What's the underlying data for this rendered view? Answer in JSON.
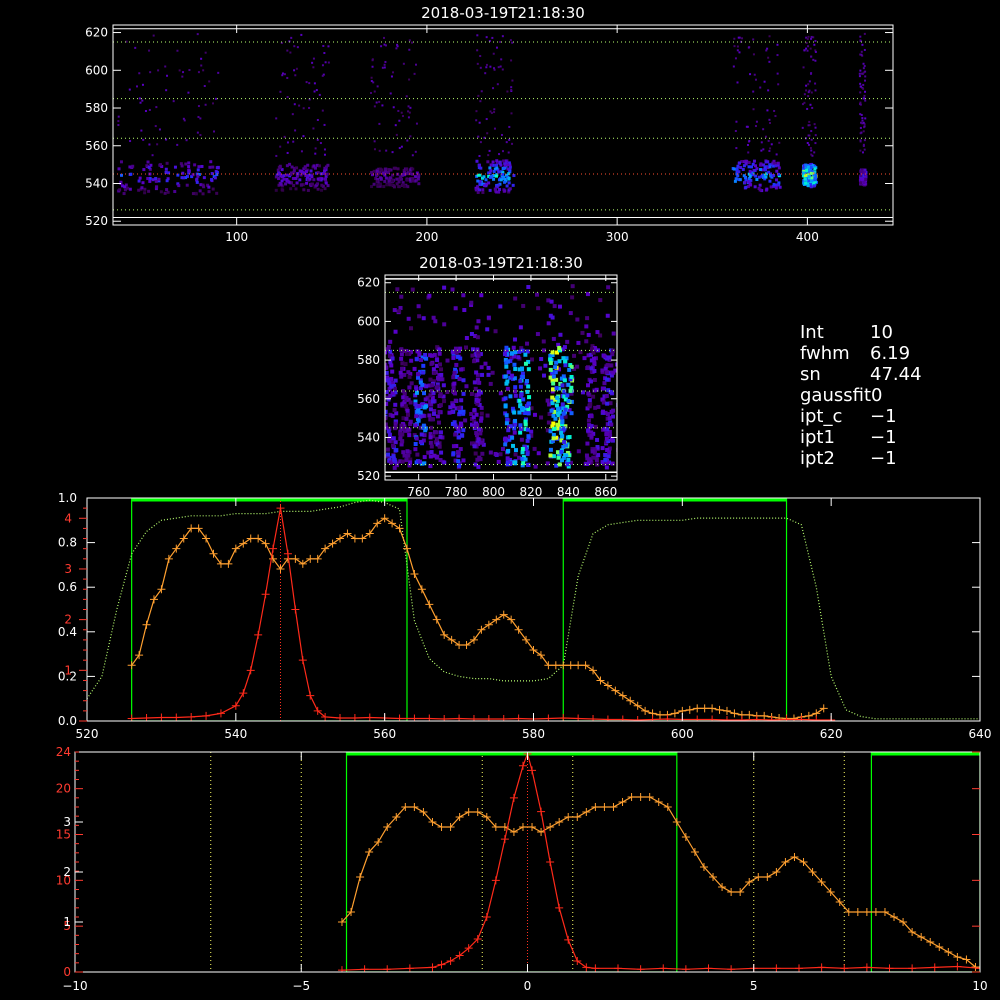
{
  "info_panel": [
    {
      "key": "Int",
      "value": "10"
    },
    {
      "key": "fwhm",
      "value": "6.19"
    },
    {
      "key": "sn",
      "value": "47.44"
    },
    {
      "key": "gaussfit",
      "value": "0"
    },
    {
      "key": "ipt_c",
      "value": "−1"
    },
    {
      "key": "ipt1",
      "value": "−1"
    },
    {
      "key": "ipt2",
      "value": "−1"
    }
  ],
  "colors": {
    "background": "#000000",
    "axes": "#ffffff",
    "mean_profile": "#ffa030",
    "line_profile": "#ff2a1a",
    "window": "#00ff00",
    "throughput": "#b8ff70",
    "guide_lines": "#ffff66"
  },
  "chart_data": [
    {
      "type": "heatmap",
      "title": "2018-03-19T21:18:30",
      "x_range": [
        35,
        445
      ],
      "y_range": [
        518,
        624
      ],
      "x_ticks": [
        100,
        200,
        300,
        400
      ],
      "y_ticks": [
        520,
        540,
        560,
        580,
        600,
        620
      ],
      "guide_lines_y": [
        526,
        545,
        564,
        585,
        615
      ],
      "intensity_blocks": [
        {
          "x": [
            37,
            90
          ],
          "y": [
            535,
            553
          ],
          "level": 0.45
        },
        {
          "x": [
            120,
            148
          ],
          "y": [
            537,
            551
          ],
          "level": 0.35
        },
        {
          "x": [
            170,
            195
          ],
          "y": [
            539,
            549
          ],
          "level": 0.25
        },
        {
          "x": [
            225,
            245
          ],
          "y": [
            536,
            553
          ],
          "level": 0.65
        },
        {
          "x": [
            360,
            385
          ],
          "y": [
            537,
            553
          ],
          "level": 0.6
        },
        {
          "x": [
            397,
            404
          ],
          "y": [
            539,
            551
          ],
          "level": 0.85
        },
        {
          "x": [
            427,
            430
          ],
          "y": [
            540,
            548
          ],
          "level": 0.35
        }
      ],
      "grid": false
    },
    {
      "type": "heatmap",
      "title": "2018-03-19T21:18:30",
      "x_range": [
        742,
        866
      ],
      "y_range": [
        518,
        624
      ],
      "x_ticks": [
        760,
        780,
        800,
        820,
        840,
        860
      ],
      "y_ticks": [
        520,
        540,
        560,
        580,
        600,
        620
      ],
      "guide_lines_y": [
        526,
        545,
        564,
        585,
        615
      ],
      "intensity_columns": [
        {
          "x": 744,
          "level": 0.35
        },
        {
          "x": 752,
          "level": 0.25
        },
        {
          "x": 760,
          "level": 0.5
        },
        {
          "x": 768,
          "level": 0.3
        },
        {
          "x": 780,
          "level": 0.4
        },
        {
          "x": 790,
          "level": 0.3
        },
        {
          "x": 808,
          "level": 0.55
        },
        {
          "x": 815,
          "level": 0.65
        },
        {
          "x": 832,
          "level": 0.85
        },
        {
          "x": 838,
          "level": 0.75
        },
        {
          "x": 852,
          "level": 0.3
        },
        {
          "x": 860,
          "level": 0.35
        }
      ],
      "grid": false
    },
    {
      "type": "line",
      "x_range": [
        520,
        640
      ],
      "x_ticks": [
        520,
        540,
        560,
        580,
        600,
        620,
        640
      ],
      "y_left_range": [
        0,
        1.0
      ],
      "y_left_ticks": [
        "0.0",
        "0.2",
        "0.4",
        "0.6",
        "0.8",
        "1.0"
      ],
      "y_left_tick_values": [
        0,
        0.2,
        0.4,
        0.6,
        0.8,
        1.0
      ],
      "y_right_ticks": [
        "1",
        "2",
        "3",
        "4"
      ],
      "y_right_tick_values": [
        1,
        2,
        3,
        4
      ],
      "y_right_range": [
        0,
        4.4
      ],
      "windows": [
        [
          526,
          563
        ],
        [
          584,
          614
        ]
      ],
      "marker_x": 546,
      "series": [
        {
          "x": [
            520,
            522,
            524,
            526,
            528,
            530,
            532,
            534,
            536,
            538,
            540,
            542,
            544,
            546,
            548,
            550,
            552,
            554,
            556,
            558,
            560,
            562,
            564,
            566,
            568,
            570,
            572,
            574,
            576,
            578,
            580,
            582,
            584,
            586,
            588,
            590,
            592,
            594,
            596,
            598,
            600,
            602,
            604,
            606,
            608,
            610,
            612,
            614,
            616,
            618,
            620,
            622,
            624,
            626,
            628,
            630,
            632,
            634,
            636,
            638,
            640
          ],
          "y": [
            0.1,
            0.2,
            0.5,
            0.75,
            0.85,
            0.9,
            0.91,
            0.92,
            0.92,
            0.92,
            0.93,
            0.93,
            0.93,
            0.94,
            0.94,
            0.94,
            0.95,
            0.96,
            0.98,
            0.99,
            0.98,
            0.95,
            0.45,
            0.28,
            0.22,
            0.2,
            0.19,
            0.19,
            0.18,
            0.18,
            0.18,
            0.19,
            0.25,
            0.65,
            0.84,
            0.88,
            0.89,
            0.9,
            0.9,
            0.9,
            0.9,
            0.91,
            0.91,
            0.91,
            0.91,
            0.91,
            0.91,
            0.91,
            0.88,
            0.6,
            0.2,
            0.05,
            0.02,
            0.01,
            0.01,
            0.01,
            0.01,
            0.01,
            0.01,
            0.01,
            0.01
          ]
        },
        {
          "x": [
            526,
            527,
            528,
            529,
            530,
            531,
            532,
            533,
            534,
            535,
            536,
            537,
            538,
            539,
            540,
            541,
            542,
            543,
            544,
            545,
            546,
            547,
            548,
            549,
            550,
            551,
            552,
            553,
            554,
            555,
            556,
            557,
            558,
            559,
            560,
            561,
            562,
            563,
            564,
            565,
            566,
            567,
            568,
            569,
            570,
            571,
            572,
            573,
            574,
            575,
            576,
            577,
            578,
            579,
            580,
            581,
            582,
            583,
            584,
            585,
            586,
            587,
            588,
            589,
            590,
            591,
            592,
            593,
            594,
            595,
            596,
            597,
            598,
            599,
            600,
            601,
            602,
            603,
            604,
            605,
            606,
            607,
            608,
            609,
            610,
            611,
            612,
            613,
            614,
            615,
            616,
            617,
            618,
            619
          ],
          "y": [
            1.1,
            1.3,
            1.9,
            2.4,
            2.6,
            3.2,
            3.4,
            3.6,
            3.8,
            3.8,
            3.6,
            3.3,
            3.1,
            3.1,
            3.4,
            3.5,
            3.6,
            3.6,
            3.5,
            3.2,
            3.0,
            3.2,
            3.2,
            3.1,
            3.2,
            3.2,
            3.4,
            3.5,
            3.6,
            3.7,
            3.6,
            3.6,
            3.7,
            3.9,
            4.0,
            3.9,
            3.8,
            3.4,
            2.9,
            2.6,
            2.3,
            2.0,
            1.7,
            1.6,
            1.5,
            1.5,
            1.6,
            1.8,
            1.9,
            2.0,
            2.1,
            2.0,
            1.8,
            1.6,
            1.4,
            1.3,
            1.1,
            1.1,
            1.1,
            1.1,
            1.1,
            1.1,
            1.0,
            0.8,
            0.7,
            0.6,
            0.5,
            0.4,
            0.3,
            0.2,
            0.15,
            0.12,
            0.12,
            0.15,
            0.2,
            0.22,
            0.25,
            0.25,
            0.25,
            0.22,
            0.2,
            0.15,
            0.12,
            0.12,
            0.1,
            0.1,
            0.08,
            0.06,
            0.05,
            0.05,
            0.08,
            0.1,
            0.15,
            0.25
          ]
        },
        {
          "x": [
            526,
            528,
            530,
            532,
            534,
            536,
            538,
            540,
            541,
            542,
            543,
            544,
            545,
            546,
            547,
            548,
            549,
            550,
            551,
            552,
            554,
            556,
            558,
            560,
            562,
            564,
            566,
            568,
            570,
            572,
            574,
            576,
            578,
            580,
            582,
            584,
            586,
            588,
            590,
            592,
            594,
            596,
            598,
            600,
            602,
            604,
            606,
            608,
            610,
            612,
            614,
            616,
            618,
            620
          ],
          "y": [
            0.05,
            0.06,
            0.07,
            0.07,
            0.08,
            0.1,
            0.15,
            0.3,
            0.55,
            1.0,
            1.7,
            2.5,
            3.4,
            4.2,
            3.3,
            2.2,
            1.2,
            0.5,
            0.2,
            0.08,
            0.06,
            0.06,
            0.07,
            0.06,
            0.05,
            0.05,
            0.05,
            0.04,
            0.05,
            0.04,
            0.04,
            0.04,
            0.05,
            0.04,
            0.05,
            0.06,
            0.05,
            0.04,
            0.03,
            0.03,
            0.02,
            0.03,
            0.04,
            0.03,
            0.03,
            0.03,
            0.02,
            0.02,
            0.03,
            0.02,
            0.03,
            0.03,
            0.02,
            0.02
          ]
        }
      ],
      "grid": false
    },
    {
      "type": "line",
      "x_range": [
        -10,
        10
      ],
      "x_ticks": [
        -10,
        -5,
        0,
        5,
        10
      ],
      "y_left_ticks": [
        "0",
        "5",
        "10",
        "15",
        "20",
        "24"
      ],
      "y_left_tick_values": [
        0,
        5,
        10,
        15,
        20,
        24
      ],
      "y_left_range": [
        0,
        24
      ],
      "y_right_ticks": [
        "1",
        "2",
        "3"
      ],
      "y_right_tick_values": [
        1,
        2,
        3
      ],
      "y_right_range": [
        0,
        4.4
      ],
      "windows": [
        [
          -4.0,
          3.3
        ],
        [
          7.6,
          10
        ]
      ],
      "guide_lines_x": [
        -7,
        -5,
        -1,
        1,
        5,
        7
      ],
      "marker_x": 0,
      "series": [
        {
          "x": [
            -4.1,
            -3.9,
            -3.7,
            -3.5,
            -3.3,
            -3.1,
            -2.9,
            -2.7,
            -2.5,
            -2.3,
            -2.1,
            -1.9,
            -1.7,
            -1.5,
            -1.3,
            -1.1,
            -0.9,
            -0.7,
            -0.5,
            -0.3,
            -0.1,
            0.1,
            0.3,
            0.5,
            0.7,
            0.9,
            1.1,
            1.3,
            1.5,
            1.7,
            1.9,
            2.1,
            2.3,
            2.5,
            2.7,
            2.9,
            3.1,
            3.3,
            3.5,
            3.7,
            3.9,
            4.1,
            4.3,
            4.5,
            4.7,
            4.9,
            5.1,
            5.3,
            5.5,
            5.7,
            5.9,
            6.1,
            6.3,
            6.5,
            6.7,
            6.9,
            7.1,
            7.3,
            7.5,
            7.7,
            7.9,
            8.1,
            8.3,
            8.5,
            8.7,
            8.9,
            9.1,
            9.3,
            9.5,
            9.7,
            9.9
          ],
          "y": [
            1.0,
            1.2,
            1.9,
            2.4,
            2.6,
            2.9,
            3.1,
            3.3,
            3.3,
            3.2,
            3.0,
            2.9,
            2.9,
            3.1,
            3.2,
            3.2,
            3.1,
            2.9,
            2.9,
            2.8,
            2.9,
            2.9,
            2.8,
            2.9,
            3.0,
            3.1,
            3.1,
            3.2,
            3.3,
            3.3,
            3.3,
            3.4,
            3.5,
            3.5,
            3.5,
            3.4,
            3.3,
            3.0,
            2.7,
            2.4,
            2.1,
            1.9,
            1.7,
            1.6,
            1.6,
            1.8,
            1.9,
            1.9,
            2.0,
            2.2,
            2.3,
            2.2,
            2.0,
            1.8,
            1.6,
            1.4,
            1.2,
            1.2,
            1.2,
            1.2,
            1.2,
            1.1,
            1.0,
            0.8,
            0.7,
            0.6,
            0.5,
            0.4,
            0.3,
            0.25,
            0.1
          ]
        },
        {
          "x": [
            -4.1,
            -3.6,
            -3.1,
            -2.6,
            -2.1,
            -1.9,
            -1.7,
            -1.5,
            -1.3,
            -1.1,
            -0.9,
            -0.7,
            -0.5,
            -0.3,
            -0.1,
            0,
            0.1,
            0.3,
            0.5,
            0.7,
            0.9,
            1.1,
            1.3,
            1.5,
            2.0,
            2.5,
            3.0,
            3.5,
            4.0,
            4.5,
            5.0,
            5.5,
            6.0,
            6.5,
            7.0,
            7.5,
            8.0,
            8.5,
            9.0,
            9.5,
            10.0
          ],
          "y": [
            0.2,
            0.3,
            0.3,
            0.4,
            0.5,
            0.8,
            1.2,
            1.8,
            2.6,
            3.6,
            6.0,
            10.0,
            14.5,
            19.0,
            22.5,
            23.8,
            22.0,
            17.5,
            12.0,
            7.0,
            3.5,
            1.2,
            0.5,
            0.4,
            0.4,
            0.3,
            0.4,
            0.3,
            0.4,
            0.3,
            0.4,
            0.4,
            0.4,
            0.5,
            0.4,
            0.5,
            0.4,
            0.4,
            0.5,
            0.6,
            0.4
          ]
        }
      ],
      "grid": false
    }
  ]
}
